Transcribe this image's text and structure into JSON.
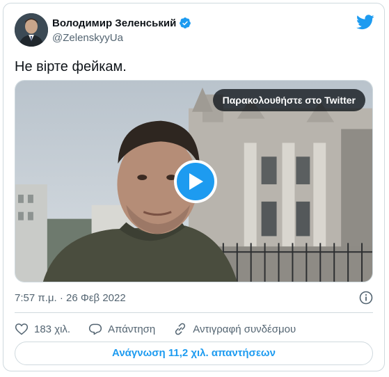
{
  "author": {
    "display_name": "Володимир Зеленський",
    "handle": "@ZelenskyyUa",
    "verified": true
  },
  "tweet": {
    "text": "Не вірте фейкам.",
    "timestamp": "7:57 π.μ. · 26 Φεβ 2022"
  },
  "media": {
    "watch_label": "Παρακολουθήστε στο Twitter",
    "type": "video"
  },
  "actions": {
    "likes": "183 χιλ.",
    "reply": "Απάντηση",
    "copy_link": "Αντιγραφή συνδέσμου"
  },
  "replies_button": "Ανάγνωση 11,2 χιλ. απαντήσεων",
  "colors": {
    "accent": "#1d9bf0",
    "text": "#0f1419",
    "muted": "#536471",
    "border": "#cfd9de"
  },
  "icons": [
    "twitter-bird-icon",
    "verified-badge-icon",
    "play-icon",
    "info-icon",
    "heart-icon",
    "reply-icon",
    "link-icon"
  ]
}
